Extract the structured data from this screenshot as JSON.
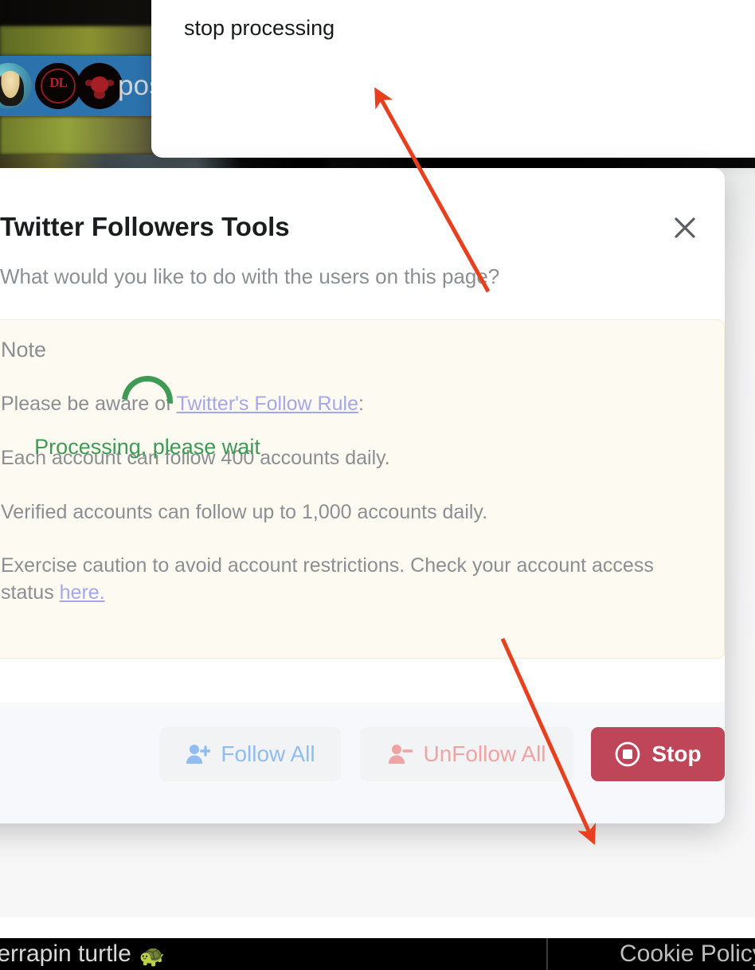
{
  "tooltip": {
    "text": "stop processing"
  },
  "background": {
    "banner_text": "pos",
    "cookie_bar": {
      "left_text": "terrapin turtle",
      "turtle_icon": "turtle-emoji",
      "turtle_glyph": "🐢",
      "right_text": "Cookie Policy"
    }
  },
  "modal": {
    "title": "Twitter Followers Tools",
    "close_icon": "close-x-icon",
    "question": "What would you like to do with the users on this page?",
    "note": {
      "title": "Note",
      "lines": [
        "Please be aware of ",
        "Each account can follow 400 accounts daily.",
        "Verified accounts can follow up to 1,000 accounts daily.",
        "Exercise caution to avoid account restrictions. Check your account access status "
      ],
      "link_follow_rule": "Twitter's Follow Rule",
      "colon": ":",
      "link_here": "here."
    },
    "status": {
      "spinner_icon": "loading-spinner-icon",
      "text": "Processing, please wait",
      "color": "#3f9a56"
    },
    "footer": {
      "follow_all": {
        "label": "Follow All",
        "icon": "user-plus-icon",
        "color": "#90bdf0"
      },
      "unfollow_all": {
        "label": "UnFollow All",
        "icon": "user-minus-icon",
        "color": "#f0a3a3"
      },
      "stop": {
        "label": "Stop",
        "icon": "stop-circle-icon",
        "color": "#bf4659"
      }
    }
  },
  "annotations": {
    "arrow_color": "#e8401f",
    "arrow_1": "arrow-to-tooltip",
    "arrow_2": "arrow-to-stop-button"
  }
}
